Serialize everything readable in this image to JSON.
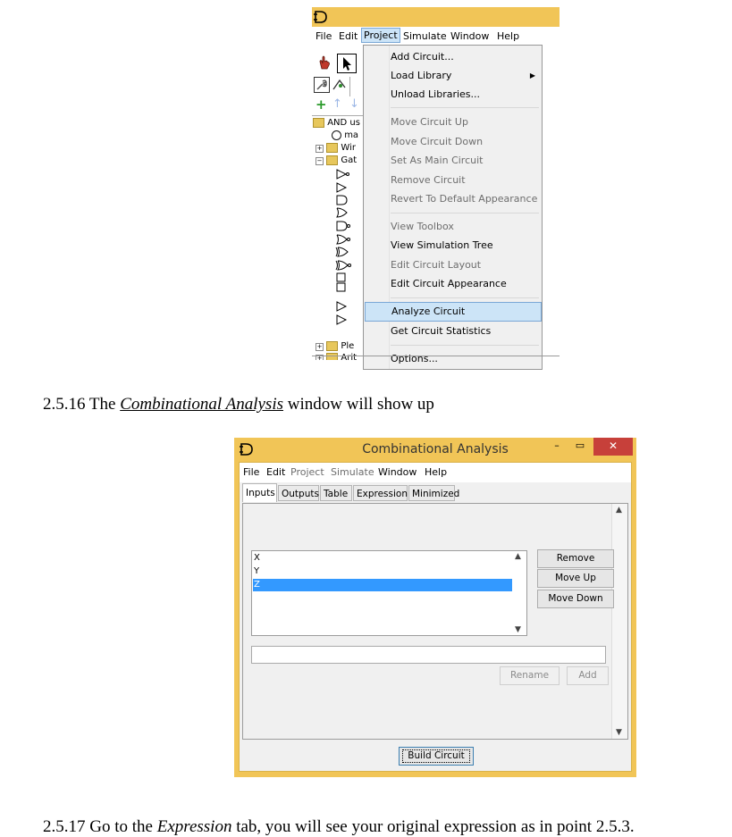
{
  "screenshot1": {
    "menubar": [
      "File",
      "Edit",
      "Project",
      "Simulate",
      "Window",
      "Help"
    ],
    "active_menu": "Project",
    "project_menu": {
      "group1": [
        {
          "label": "Add Circuit...",
          "enabled": true
        },
        {
          "label": "Load Library",
          "enabled": true,
          "submenu": true
        },
        {
          "label": "Unload Libraries...",
          "enabled": true
        }
      ],
      "group2": [
        {
          "label": "Move Circuit Up",
          "enabled": false
        },
        {
          "label": "Move Circuit Down",
          "enabled": false
        },
        {
          "label": "Set As Main Circuit",
          "enabled": false
        },
        {
          "label": "Remove Circuit",
          "enabled": false
        },
        {
          "label": "Revert To Default Appearance",
          "enabled": false
        }
      ],
      "group3": [
        {
          "label": "View Toolbox",
          "enabled": false
        },
        {
          "label": "View Simulation Tree",
          "enabled": true
        },
        {
          "label": "Edit Circuit Layout",
          "enabled": false
        },
        {
          "label": "Edit Circuit Appearance",
          "enabled": true
        }
      ],
      "group4": [
        {
          "label": "Analyze Circuit",
          "enabled": true,
          "highlighted": true
        },
        {
          "label": "Get Circuit Statistics",
          "enabled": true
        }
      ],
      "group5": [
        {
          "label": "Options...",
          "enabled": true
        }
      ]
    },
    "tree": {
      "root": "AND us",
      "item_main": "ma",
      "item_wiring": "Wir",
      "item_gates": "Gat",
      "item_plexers": "Ple",
      "item_arith": "Arit"
    }
  },
  "caption1": {
    "prefix": "2.5.16 The ",
    "emph": "Combinational Analysis",
    "suffix": " window will show up"
  },
  "screenshot2": {
    "window_title": "Combinational Analysis",
    "menubar": [
      {
        "label": "File",
        "enabled": true
      },
      {
        "label": "Edit",
        "enabled": true
      },
      {
        "label": "Project",
        "enabled": false
      },
      {
        "label": "Simulate",
        "enabled": false
      },
      {
        "label": "Window",
        "enabled": true
      },
      {
        "label": "Help",
        "enabled": true
      }
    ],
    "tabs": [
      "Inputs",
      "Outputs",
      "Table",
      "Expression",
      "Minimized"
    ],
    "selected_tab": "Inputs",
    "variables": [
      "X",
      "Y",
      "Z"
    ],
    "selected_variable": "Z",
    "buttons": {
      "remove": "Remove",
      "move_up": "Move Up",
      "move_down": "Move Down",
      "rename": "Rename",
      "add": "Add",
      "build": "Build Circuit"
    },
    "name_field_value": "",
    "colors": {
      "frame": "#f1c557",
      "close": "#c7403a",
      "selection": "#3399ff"
    }
  },
  "caption2": {
    "prefix": "2.5.17 Go to the ",
    "emph": "Expression",
    "suffix": " tab, you will see your original expression as in point 2.5.3."
  }
}
